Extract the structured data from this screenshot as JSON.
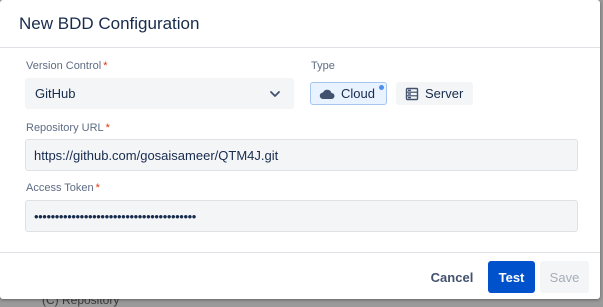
{
  "backdrop": {
    "text": "(C) Repository"
  },
  "dialog": {
    "title": "New BDD Configuration"
  },
  "form": {
    "version_control": {
      "label": "Version Control",
      "required_mark": "*",
      "value": "GitHub"
    },
    "type": {
      "label": "Type",
      "options": [
        {
          "label": "Cloud",
          "icon": "cloud-icon",
          "selected": true
        },
        {
          "label": "Server",
          "icon": "server-icon",
          "selected": false
        }
      ]
    },
    "repository_url": {
      "label": "Repository URL",
      "required_mark": "*",
      "value": "https://github.com/gosaisameer/QTM4J.git"
    },
    "access_token": {
      "label": "Access Token",
      "required_mark": "*",
      "value": "•••••••••••••••••••••••••••••••••••••••"
    }
  },
  "footer": {
    "cancel_label": "Cancel",
    "test_label": "Test",
    "save_label": "Save"
  },
  "colors": {
    "primary": "#0052cc",
    "required": "#de350b",
    "selected_bg": "#e9f2ff"
  }
}
